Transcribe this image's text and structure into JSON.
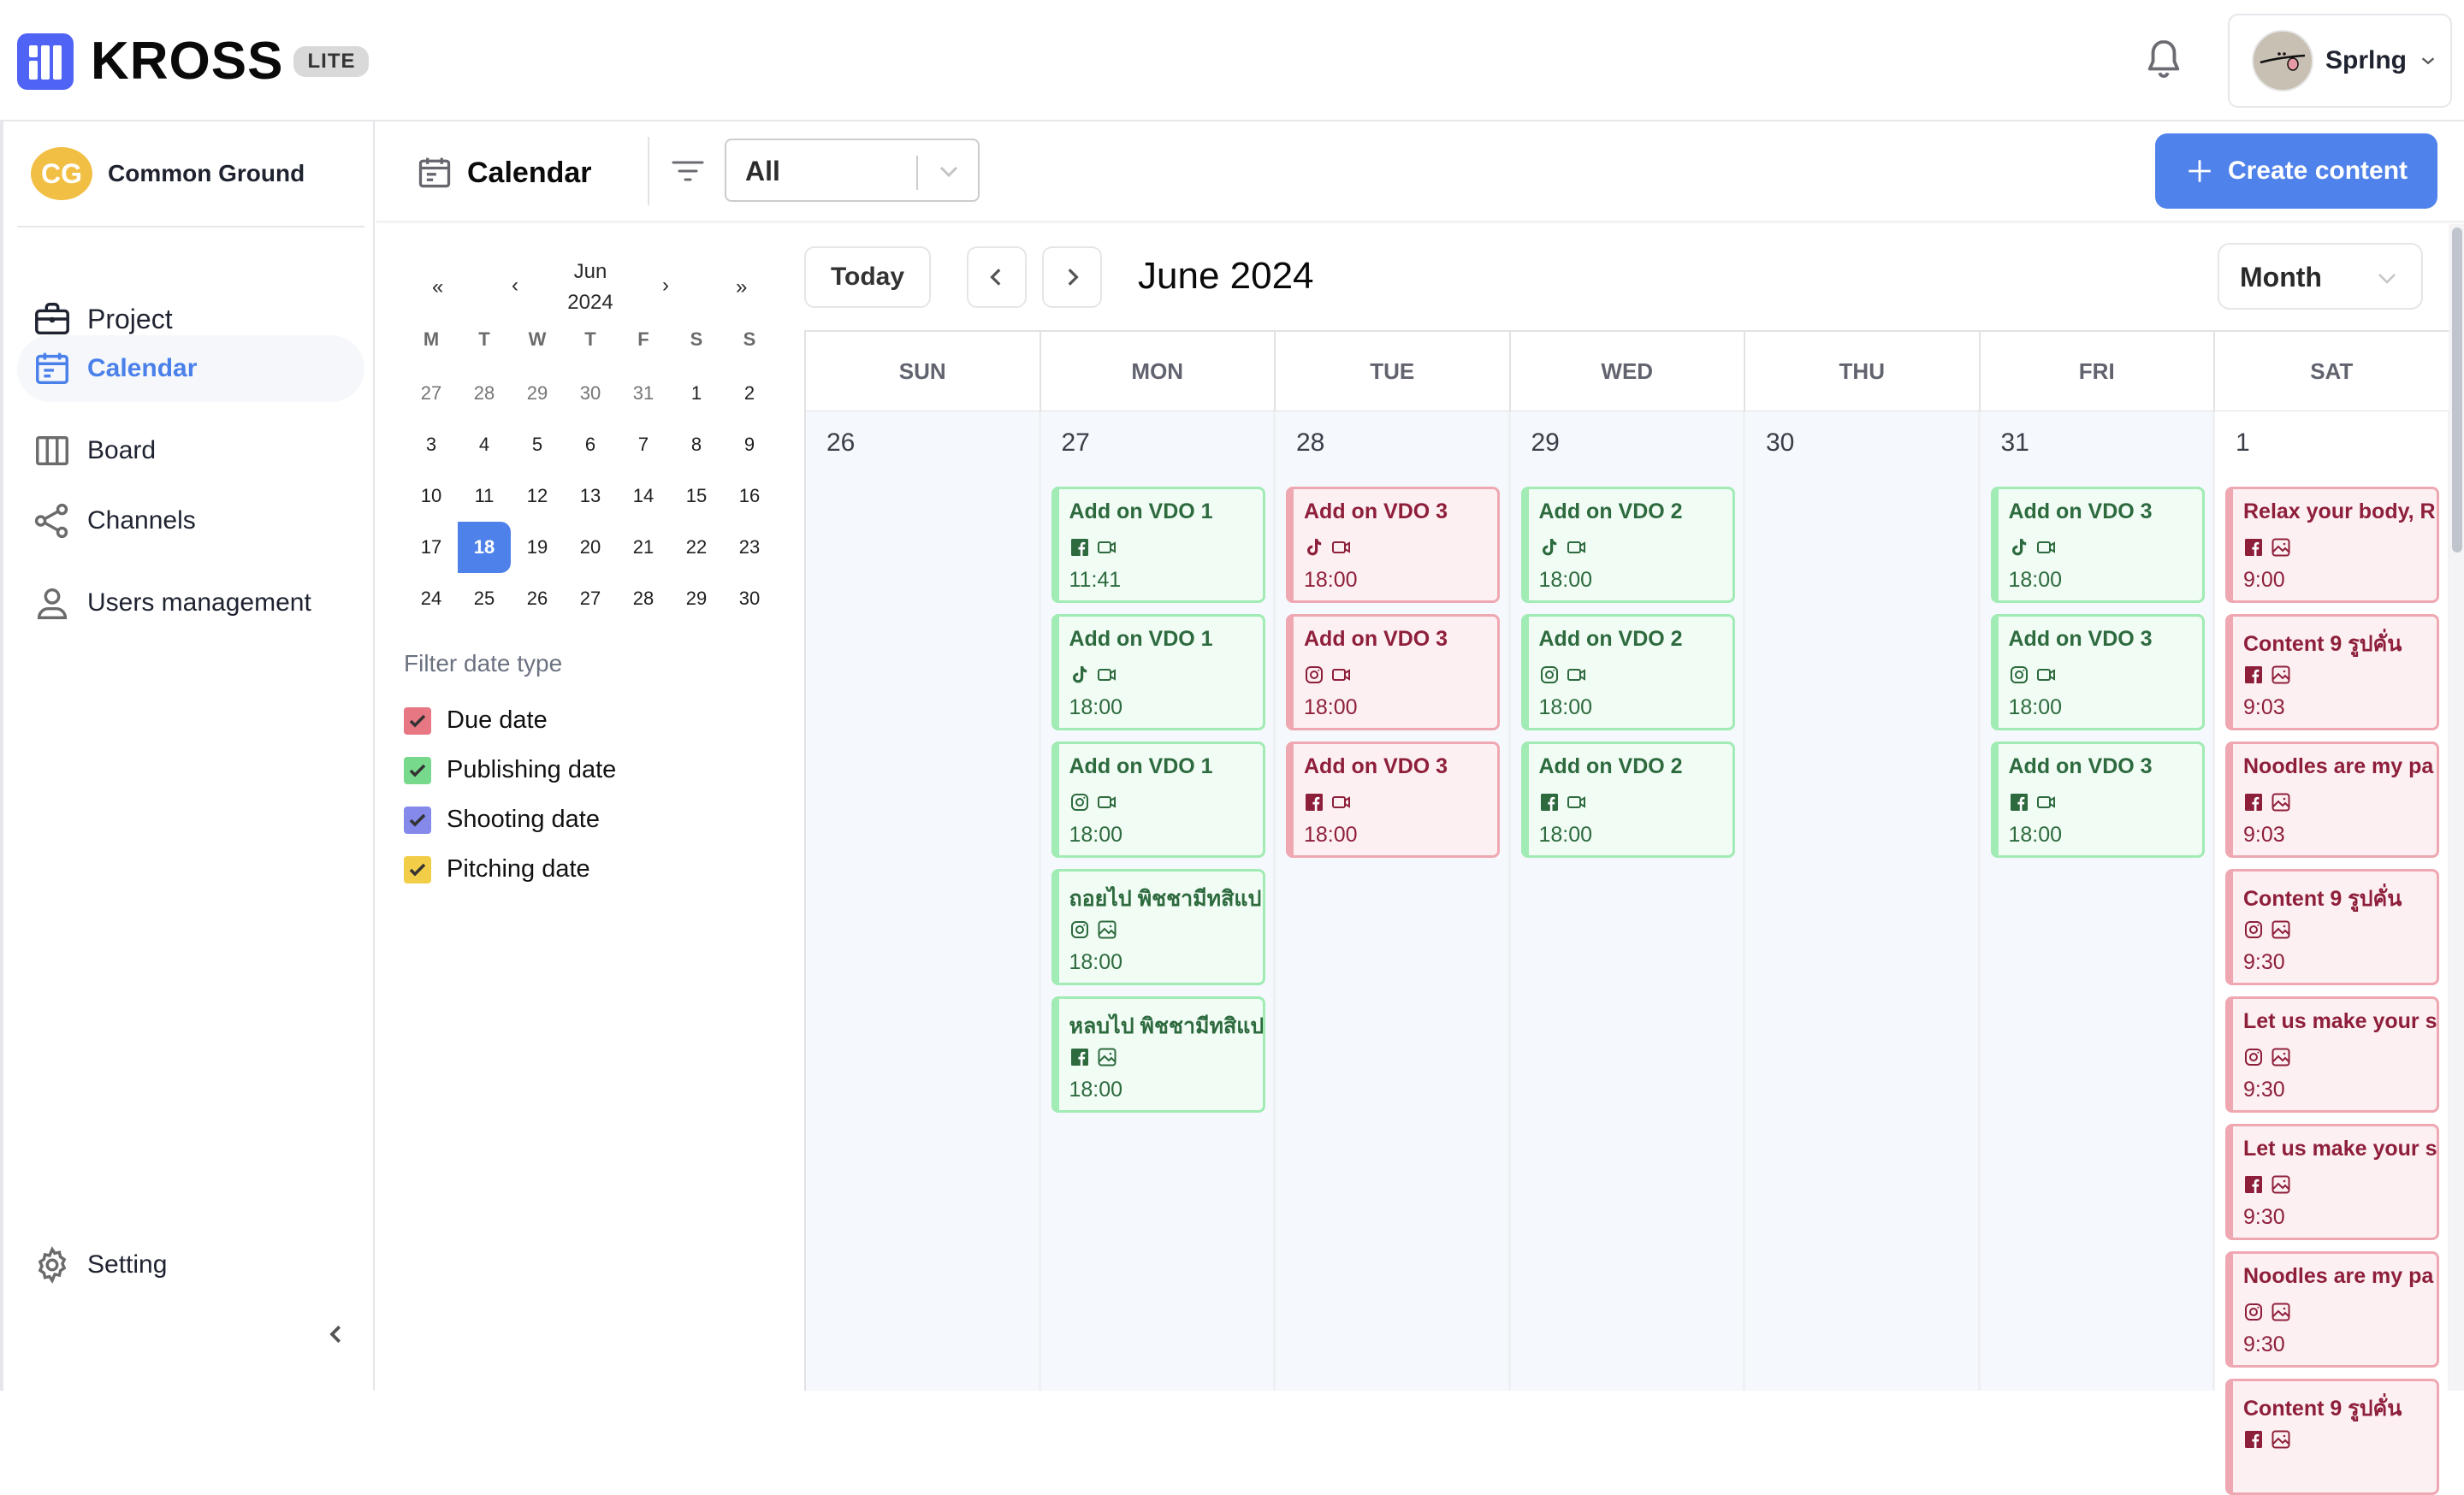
{
  "app": {
    "name": "KROSS",
    "badge": "LITE",
    "brand_color": "#4f63f5"
  },
  "header": {
    "notification_icon": "bell-icon",
    "user": {
      "name": "Sprlng",
      "avatar": "avatar-image"
    }
  },
  "sidebar": {
    "org": {
      "initials": "CG",
      "name": "Common Ground",
      "color": "#f2bf45"
    },
    "items": [
      {
        "label": "Project",
        "icon": "briefcase-icon",
        "active": false
      },
      {
        "label": "Calendar",
        "icon": "calendar-icon",
        "active": true
      },
      {
        "label": "Board",
        "icon": "columns-icon",
        "active": false
      },
      {
        "label": "Channels",
        "icon": "share-icon",
        "active": false
      },
      {
        "label": "Users management",
        "icon": "user-icon",
        "active": false
      }
    ],
    "setting_label": "Setting",
    "accent_color": "#4a80ea"
  },
  "toolbar": {
    "title": "Calendar",
    "filter_value": "All",
    "create_label": "Create content"
  },
  "mini_calendar": {
    "month": "Jun",
    "year": "2024",
    "nav": {
      "prev_year": "«",
      "prev_month": "‹",
      "next_month": "›",
      "next_year": "»"
    },
    "weekdays": [
      "M",
      "T",
      "W",
      "T",
      "F",
      "S",
      "S"
    ],
    "weeks": [
      [
        {
          "d": "27",
          "m": true
        },
        {
          "d": "28",
          "m": true
        },
        {
          "d": "29",
          "m": true
        },
        {
          "d": "30",
          "m": true
        },
        {
          "d": "31",
          "m": true
        },
        {
          "d": "1"
        },
        {
          "d": "2"
        }
      ],
      [
        {
          "d": "3"
        },
        {
          "d": "4"
        },
        {
          "d": "5"
        },
        {
          "d": "6"
        },
        {
          "d": "7"
        },
        {
          "d": "8"
        },
        {
          "d": "9"
        }
      ],
      [
        {
          "d": "10"
        },
        {
          "d": "11"
        },
        {
          "d": "12"
        },
        {
          "d": "13"
        },
        {
          "d": "14"
        },
        {
          "d": "15"
        },
        {
          "d": "16"
        }
      ],
      [
        {
          "d": "17"
        },
        {
          "d": "18",
          "sel": true
        },
        {
          "d": "19"
        },
        {
          "d": "20"
        },
        {
          "d": "21"
        },
        {
          "d": "22"
        },
        {
          "d": "23"
        }
      ],
      [
        {
          "d": "24"
        },
        {
          "d": "25"
        },
        {
          "d": "26"
        },
        {
          "d": "27"
        },
        {
          "d": "28"
        },
        {
          "d": "29"
        },
        {
          "d": "30"
        }
      ]
    ],
    "selected_day": "18"
  },
  "filter_date_type": {
    "title": "Filter date type",
    "options": [
      {
        "label": "Due date",
        "checked": true,
        "color": "#e87784"
      },
      {
        "label": "Publishing date",
        "checked": true,
        "color": "#77d98c"
      },
      {
        "label": "Shooting date",
        "checked": true,
        "color": "#8489ea"
      },
      {
        "label": "Pitching date",
        "checked": true,
        "color": "#f2cd48"
      }
    ]
  },
  "calendar": {
    "today_label": "Today",
    "title": "June 2024",
    "view": "Month",
    "weekdays": [
      "SUN",
      "MON",
      "TUE",
      "WED",
      "THU",
      "FRI",
      "SAT"
    ],
    "days": [
      {
        "num": "26",
        "current": false,
        "events": []
      },
      {
        "num": "27",
        "current": false,
        "events": [
          {
            "title": "Add on VDO 1",
            "platform": "facebook",
            "type": "video",
            "time": "11:41",
            "kind": "green"
          },
          {
            "title": "Add on VDO 1",
            "platform": "tiktok",
            "type": "video",
            "time": "18:00",
            "kind": "green"
          },
          {
            "title": "Add on VDO 1",
            "platform": "instagram",
            "type": "video",
            "time": "18:00",
            "kind": "green"
          },
          {
            "title": "ถอยไป พิชชามีทสิแปล",
            "platform": "instagram",
            "type": "image",
            "time": "18:00",
            "kind": "green"
          },
          {
            "title": "หลบไป พิชชามีทสิแปล",
            "platform": "facebook",
            "type": "image",
            "time": "18:00",
            "kind": "green"
          }
        ]
      },
      {
        "num": "28",
        "current": false,
        "events": [
          {
            "title": "Add on VDO 3",
            "platform": "tiktok",
            "type": "video",
            "time": "18:00",
            "kind": "red"
          },
          {
            "title": "Add on VDO 3",
            "platform": "instagram",
            "type": "video",
            "time": "18:00",
            "kind": "red"
          },
          {
            "title": "Add on VDO 3",
            "platform": "facebook",
            "type": "video",
            "time": "18:00",
            "kind": "red"
          }
        ]
      },
      {
        "num": "29",
        "current": false,
        "events": [
          {
            "title": "Add on VDO 2",
            "platform": "tiktok",
            "type": "video",
            "time": "18:00",
            "kind": "green"
          },
          {
            "title": "Add on VDO 2",
            "platform": "instagram",
            "type": "video",
            "time": "18:00",
            "kind": "green"
          },
          {
            "title": "Add on VDO 2",
            "platform": "facebook",
            "type": "video",
            "time": "18:00",
            "kind": "green"
          }
        ]
      },
      {
        "num": "30",
        "current": false,
        "events": []
      },
      {
        "num": "31",
        "current": false,
        "events": [
          {
            "title": "Add on VDO 3",
            "platform": "tiktok",
            "type": "video",
            "time": "18:00",
            "kind": "green"
          },
          {
            "title": "Add on VDO 3",
            "platform": "instagram",
            "type": "video",
            "time": "18:00",
            "kind": "green"
          },
          {
            "title": "Add on VDO 3",
            "platform": "facebook",
            "type": "video",
            "time": "18:00",
            "kind": "green"
          }
        ]
      },
      {
        "num": "1",
        "current": true,
        "events": [
          {
            "title": "Relax your body, R",
            "platform": "facebook",
            "type": "image",
            "time": "9:00",
            "kind": "red"
          },
          {
            "title": "Content 9 รูปคั่น",
            "platform": "facebook",
            "type": "image",
            "time": "9:03",
            "kind": "red"
          },
          {
            "title": "Noodles are my pa",
            "platform": "facebook",
            "type": "image",
            "time": "9:03",
            "kind": "red"
          },
          {
            "title": "Content 9 รูปคั่น",
            "platform": "instagram",
            "type": "image",
            "time": "9:30",
            "kind": "red"
          },
          {
            "title": "Let us make your s",
            "platform": "instagram",
            "type": "image",
            "time": "9:30",
            "kind": "red"
          },
          {
            "title": "Let us make your s",
            "platform": "facebook",
            "type": "image",
            "time": "9:30",
            "kind": "red"
          },
          {
            "title": "Noodles are my pa",
            "platform": "instagram",
            "type": "image",
            "time": "9:30",
            "kind": "red"
          },
          {
            "title": "Content 9 รูปคั่น",
            "platform": "facebook",
            "type": "image",
            "time": "",
            "kind": "red"
          }
        ]
      }
    ],
    "colors": {
      "publish_green": "#a1ebb4",
      "due_red": "#efa8b2"
    }
  }
}
